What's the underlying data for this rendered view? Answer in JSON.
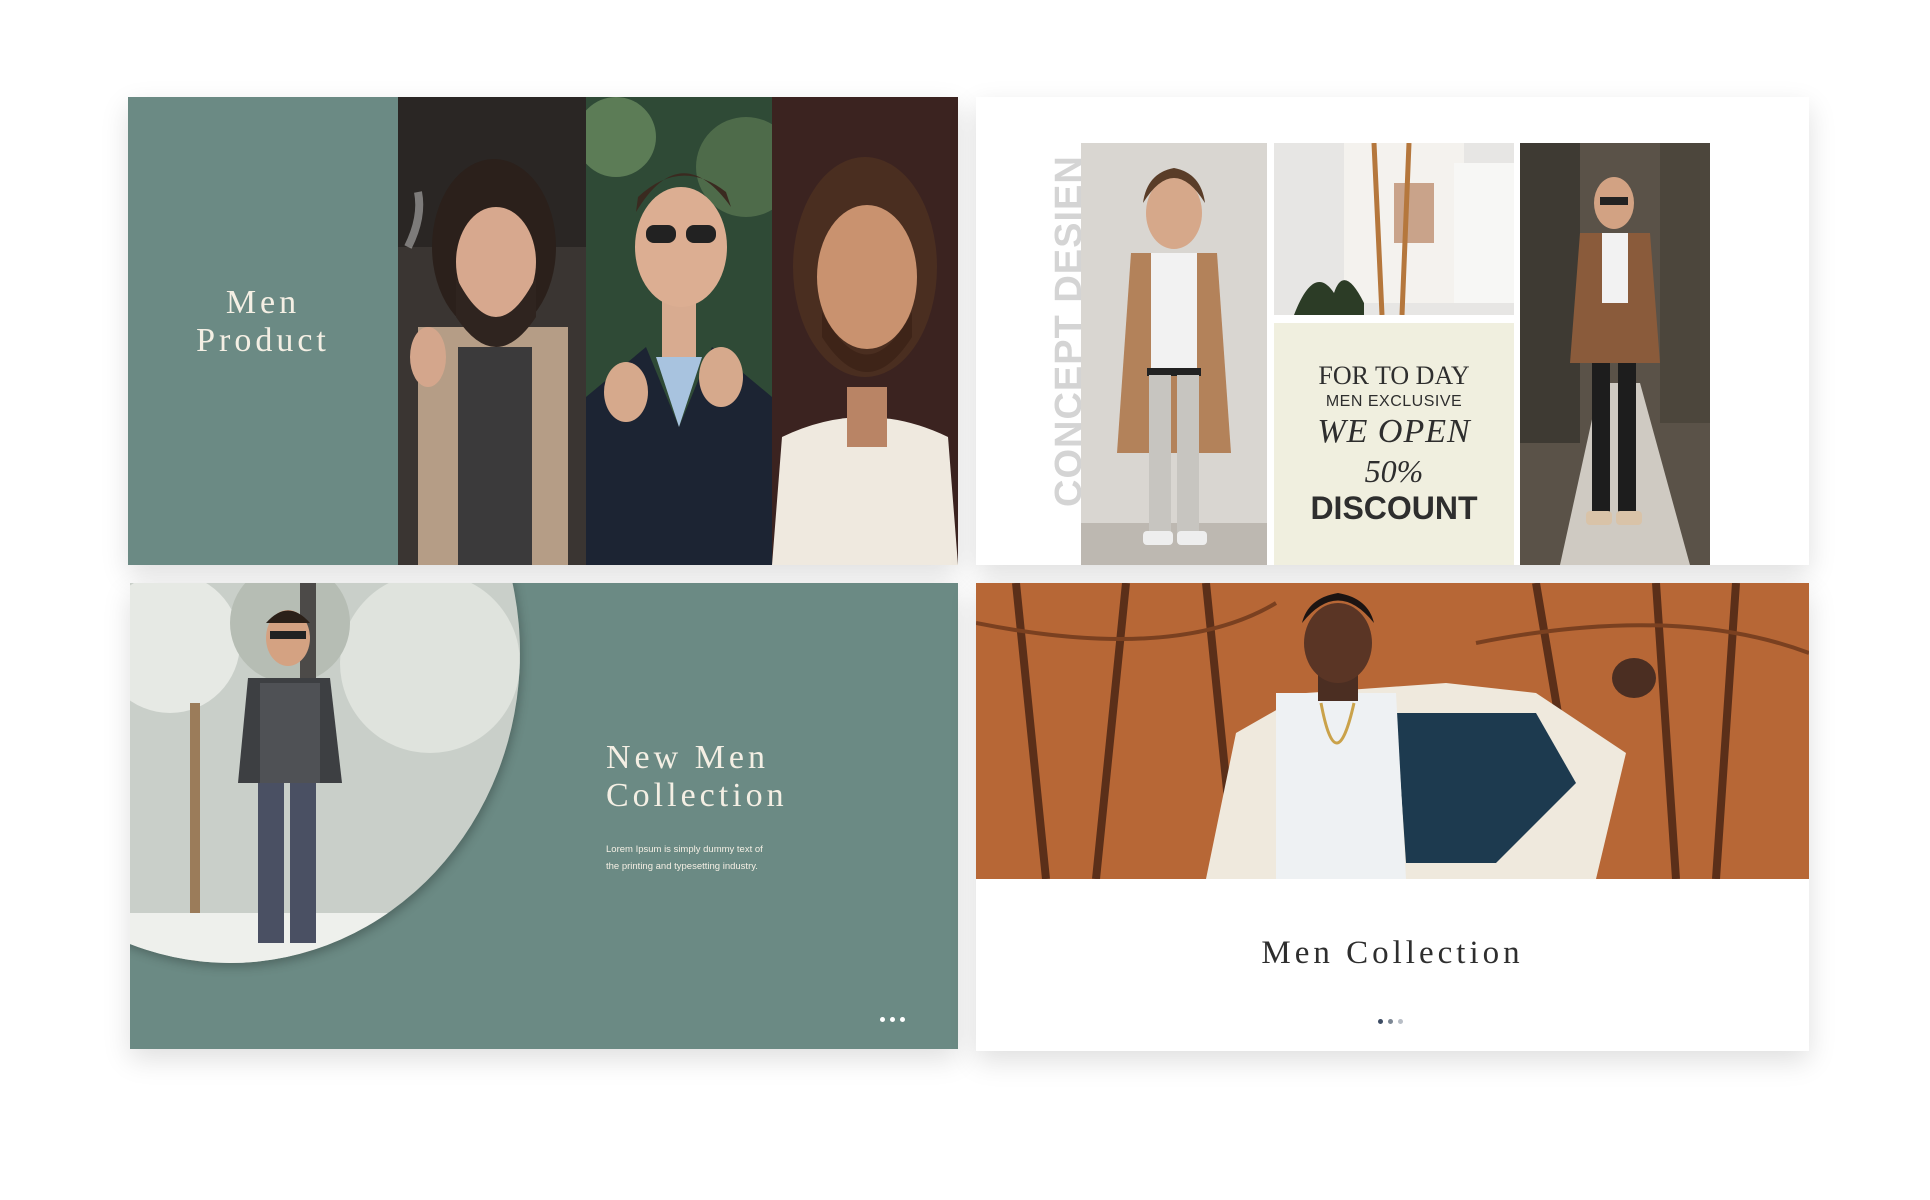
{
  "slide_men_product": {
    "title_line1": "Men",
    "title_line2": "Product",
    "accent": "#6b8a84"
  },
  "slide_concept": {
    "vertical_text": "CONCEPT DESIEN",
    "promo_line1": "FOR TO DAY",
    "promo_line2": "MEN EXCLUSIVE",
    "promo_line3": "WE OPEN",
    "promo_line4": "50%",
    "promo_line5": "DISCOUNT",
    "promo_bg": "#f0efdf"
  },
  "slide_new_collection": {
    "title_line1": "New Men",
    "title_line2": "Collection",
    "body_line1": "Lorem Ipsum is simply dummy text of",
    "body_line2": "the printing and typesetting industry.",
    "dot_color": "#ffffff"
  },
  "slide_men_collection": {
    "title": "Men Collection",
    "dot_colors": [
      "#3c4b63",
      "#7c8794",
      "#b8bec6"
    ]
  }
}
